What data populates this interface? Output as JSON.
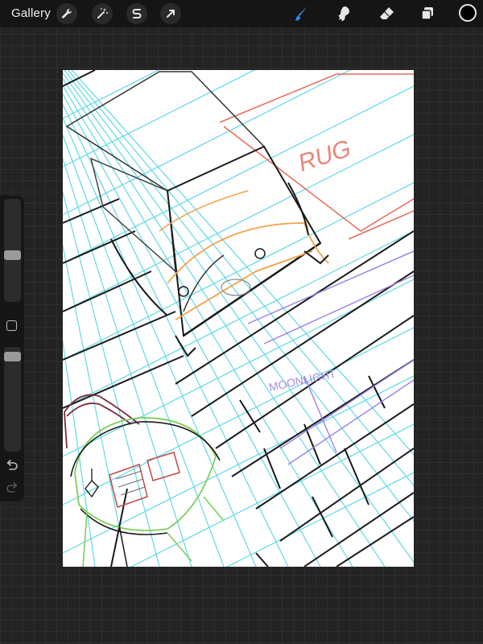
{
  "topbar": {
    "gallery_label": "Gallery",
    "left_tools": [
      {
        "name": "actions",
        "icon": "wrench-icon"
      },
      {
        "name": "adjustments",
        "icon": "magic-wand-icon"
      },
      {
        "name": "selection",
        "icon": "selection-s-icon"
      },
      {
        "name": "transform",
        "icon": "arrow-cursor-icon"
      }
    ],
    "right_tools": [
      {
        "name": "brush",
        "icon": "brush-icon",
        "active": true
      },
      {
        "name": "smudge",
        "icon": "smudge-icon",
        "active": false
      },
      {
        "name": "eraser",
        "icon": "eraser-icon",
        "active": false
      },
      {
        "name": "layers",
        "icon": "layers-icon",
        "active": false
      }
    ],
    "current_color": "#000000",
    "active_tool_color": "#2f8fe8"
  },
  "canvas": {
    "annotations": [
      {
        "text": "RUG",
        "color": "#e8867a"
      },
      {
        "text": "MOONLIGHT",
        "color": "#a889e0"
      }
    ],
    "stroke_colors": {
      "perspective_guides": "#5fd8e6",
      "ink": "#1a1a1a",
      "bed_frame": "#f0a24a",
      "rug_outline": "#e86a5a",
      "moonlight": "#9b7fe6",
      "table_cloth": "#7ccf5a"
    }
  },
  "sidebar": {
    "brush_size_level": 0.45,
    "opacity_level": 0.05,
    "undo_icon": "undo-icon",
    "redo_icon": "redo-icon"
  }
}
